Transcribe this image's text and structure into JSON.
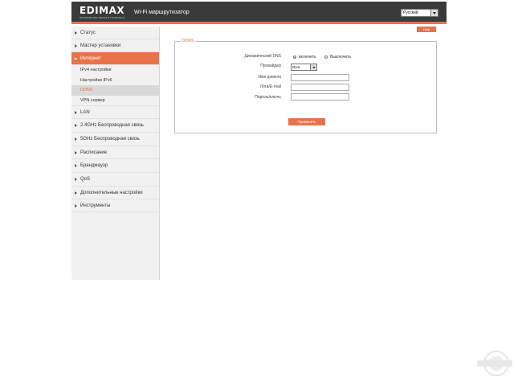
{
  "header": {
    "brand": "EDIMAX",
    "tagline": "NETWORKING PEOPLE TOGETHER",
    "title": "Wi-Fi маршрутизатор",
    "language": "Русский"
  },
  "help_label": "Help",
  "sidebar": {
    "items": [
      {
        "label": "Статус"
      },
      {
        "label": "Мастер установки"
      },
      {
        "label": "Интернет"
      },
      {
        "label": "IPv4 настройки"
      },
      {
        "label": "Настройки IPv6"
      },
      {
        "label": "DDNS"
      },
      {
        "label": "VPN сервер"
      },
      {
        "label": "LAN"
      },
      {
        "label": "2.4GHz Беспроводная связь"
      },
      {
        "label": "5GHz Беспроводная связь"
      },
      {
        "label": "Расписание"
      },
      {
        "label": "Брандмауэр"
      },
      {
        "label": "QoS"
      },
      {
        "label": "Дополнительные настройки"
      },
      {
        "label": "Инструменты"
      }
    ]
  },
  "ddns": {
    "legend": "DDNS",
    "dynamic_dns_label": "Динамический DNS",
    "enable_label": "включить",
    "disable_label": "Выключить",
    "provider_label": "Провайдер",
    "provider_value": "DHS",
    "domain_label": "Имя домена",
    "login_label": "Логи/E-mail",
    "password_label": "Пароль/ключь",
    "apply_label": "Применить"
  },
  "colors": {
    "accent": "#e8734a",
    "header_bg": "#3a3a3a",
    "sidebar_bg": "#f1f1f1"
  }
}
